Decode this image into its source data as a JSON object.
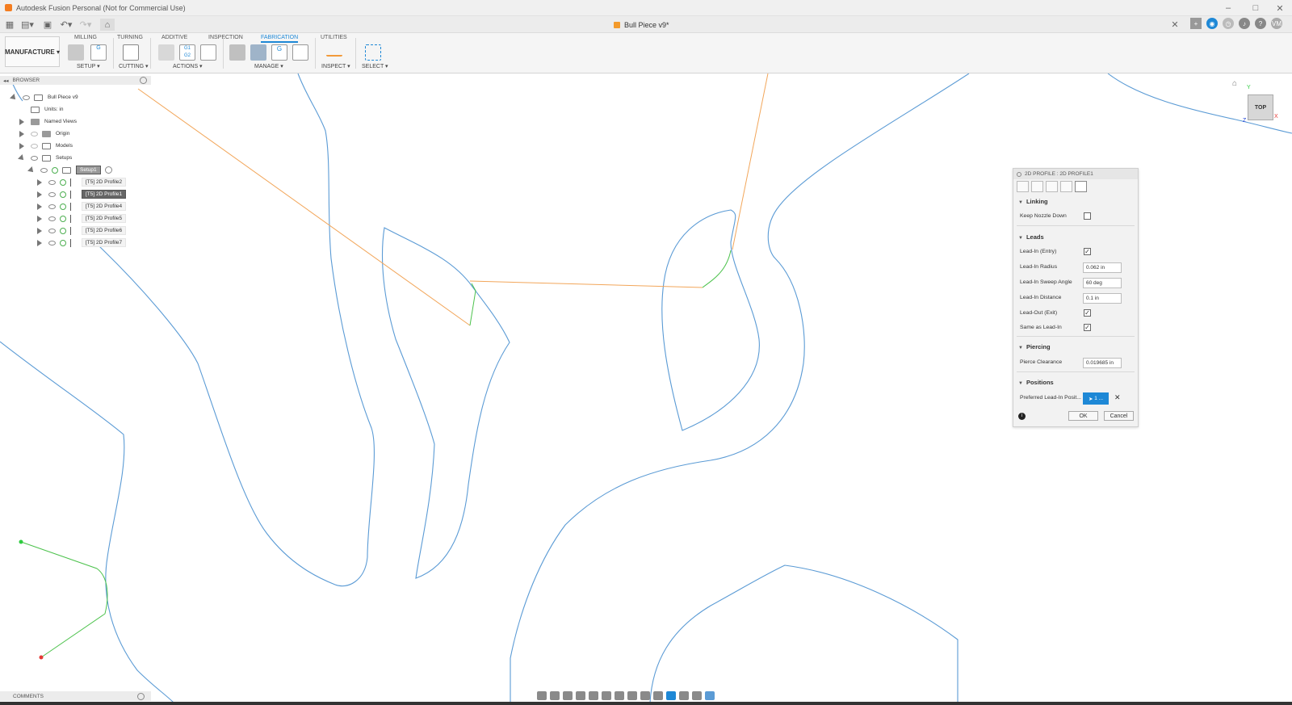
{
  "window": {
    "title": "Autodesk Fusion Personal (Not for Commercial Use)",
    "document_tab": "Bull Piece v9*"
  },
  "ribbon": {
    "workspace": "MANUFACTURE",
    "tabs": [
      "MILLING",
      "TURNING",
      "ADDITIVE",
      "INSPECTION",
      "FABRICATION",
      "UTILITIES"
    ],
    "active_tab": "FABRICATION",
    "groups": [
      "SETUP ▾",
      "CUTTING ▾",
      "ACTIONS ▾",
      "MANAGE ▾",
      "INSPECT ▾",
      "SELECT ▾"
    ],
    "actions_g_label": "G1\nG2"
  },
  "browser": {
    "header": "BROWSER",
    "root": "Bull Piece v9",
    "units": "Units: in",
    "named_views": "Named Views",
    "origin": "Origin",
    "models": "Models",
    "setups": "Setups",
    "setup1": "Setup1",
    "operations": [
      "[T5] 2D Profile2",
      "[T5] 2D Profile1",
      "[T5] 2D Profile4",
      "[T5] 2D Profile5",
      "[T5] 2D Profile6",
      "[T5] 2D Profile7"
    ],
    "selected_operation": "[T5] 2D Profile1"
  },
  "panel": {
    "title": "2D PROFILE : 2D PROFILE1",
    "sections": {
      "linking": "Linking",
      "leads": "Leads",
      "piercing": "Piercing",
      "positions": "Positions"
    },
    "fields": {
      "keep_nozzle_down": "Keep Nozzle Down",
      "lead_in_entry": "Lead-In (Entry)",
      "lead_in_radius": "Lead-In Radius",
      "lead_in_radius_value": "0.062 in",
      "lead_in_sweep_angle": "Lead-In Sweep Angle",
      "lead_in_sweep_angle_value": "60 deg",
      "lead_in_distance": "Lead-In Distance",
      "lead_in_distance_value": "0.1 in",
      "lead_out_exit": "Lead-Out (Exit)",
      "same_as_lead_in": "Same as Lead-In",
      "pierce_clearance": "Pierce Clearance",
      "pierce_clearance_value": "0.019685 in",
      "preferred_lead_in": "Preferred Lead-In Posit...",
      "preferred_lead_in_value": "1 ..."
    },
    "checks": {
      "keep_nozzle_down": false,
      "lead_in_entry": true,
      "lead_out_exit": true,
      "same_as_lead_in": true
    },
    "ok_label": "OK",
    "cancel_label": "Cancel"
  },
  "viewcube": {
    "face": "TOP",
    "axis_x": "X",
    "axis_y": "Y",
    "axis_z": "Z"
  },
  "comments": {
    "label": "COMMENTS"
  },
  "user": {
    "initials": "VM"
  },
  "colors": {
    "accent": "#1e88d6",
    "profile_line": "#5b9bd5",
    "rapid_line": "#f2a65a",
    "lead_line": "#4cc24c"
  }
}
